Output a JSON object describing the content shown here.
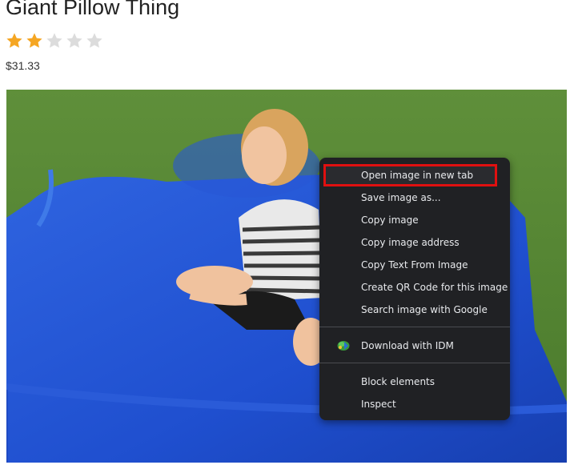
{
  "product": {
    "title": "Giant Pillow Thing",
    "rating": {
      "value": 2,
      "max": 5
    },
    "price": "$31.33"
  },
  "colors": {
    "star_filled": "#f5a623",
    "star_empty": "#dcdcdc",
    "menu_bg": "#202124",
    "menu_text": "#e8eaed",
    "highlight_border": "#e01010"
  },
  "context_menu": {
    "items": [
      {
        "label": "Open image in new tab",
        "highlighted": true
      },
      {
        "label": "Save image as..."
      },
      {
        "label": "Copy image"
      },
      {
        "label": "Copy image address"
      },
      {
        "label": "Copy Text From Image"
      },
      {
        "label": "Create QR Code for this image"
      },
      {
        "label": "Search image with Google"
      },
      {
        "label": "Download with IDM",
        "icon": "idm-icon"
      },
      {
        "label": "Block elements"
      },
      {
        "label": "Inspect"
      }
    ]
  }
}
